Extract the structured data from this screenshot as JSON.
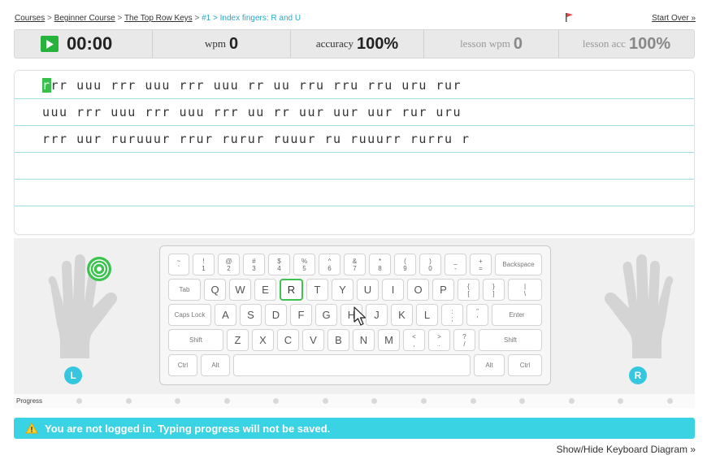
{
  "breadcrumb": {
    "items": [
      "Courses",
      "Beginner Course",
      "The Top Row Keys"
    ],
    "current": "#1 > Index fingers: R and U",
    "separator": ">"
  },
  "header": {
    "start_over": "Start Over »"
  },
  "stats": {
    "time_value": "00:00",
    "wpm_label": "wpm",
    "wpm_value": "0",
    "accuracy_label": "accuracy",
    "accuracy_value": "100%",
    "lesson_wpm_label": "lesson wpm",
    "lesson_wpm_value": "0",
    "lesson_acc_label": "lesson acc",
    "lesson_acc_value": "100%"
  },
  "lesson": {
    "current_char": "r",
    "line1_rest": "rr uuu rrr uuu rrr uuu rr uu rru rru rru uru rur",
    "line2": "uuu rrr uuu rrr uuu rrr uu rr uur uur uur rur uru",
    "line3": "rrr uur ruruuur rrur rurur ruuur ru ruuurr rurru r"
  },
  "keyboard": {
    "number_row": [
      [
        "~",
        "`"
      ],
      [
        "!",
        "1"
      ],
      [
        "@",
        "2"
      ],
      [
        "#",
        "3"
      ],
      [
        "$",
        "4"
      ],
      [
        "%",
        "5"
      ],
      [
        "^",
        "6"
      ],
      [
        "&",
        "7"
      ],
      [
        "*",
        "8"
      ],
      [
        "(",
        "9"
      ],
      [
        ")",
        "0"
      ],
      [
        "_",
        "-"
      ],
      [
        "+",
        "="
      ]
    ],
    "backspace": "Backspace",
    "tab": "Tab",
    "top_row": [
      "Q",
      "W",
      "E",
      "R",
      "T",
      "Y",
      "U",
      "I",
      "O",
      "P"
    ],
    "top_row_symbols": [
      [
        "{",
        "["
      ],
      [
        "}",
        "]"
      ],
      [
        "|",
        "\\"
      ]
    ],
    "caps": "Caps Lock",
    "home_row": [
      "A",
      "S",
      "D",
      "F",
      "G",
      "H",
      "J",
      "K",
      "L"
    ],
    "home_row_symbols": [
      [
        ":",
        ";"
      ],
      [
        "\"",
        "'"
      ]
    ],
    "enter": "Enter",
    "shift": "Shift",
    "bottom_row": [
      "Z",
      "X",
      "C",
      "V",
      "B",
      "N",
      "M"
    ],
    "bottom_row_symbols": [
      [
        "<",
        ","
      ],
      [
        ">",
        "."
      ],
      [
        "?",
        "/"
      ]
    ],
    "ctrl": "Ctrl",
    "alt": "Alt",
    "highlight_key": "R"
  },
  "hands": {
    "left_label": "L",
    "right_label": "R"
  },
  "progress": {
    "label": "Progress",
    "dot_count": 13
  },
  "warning": {
    "text": "You are not logged in. Typing progress will not be saved."
  },
  "footer": {
    "toggle_diagram": "Show/Hide Keyboard Diagram »"
  },
  "colors": {
    "accent_cyan": "#3ad3e3",
    "green": "#37c04a",
    "line": "#9fe0e6"
  }
}
